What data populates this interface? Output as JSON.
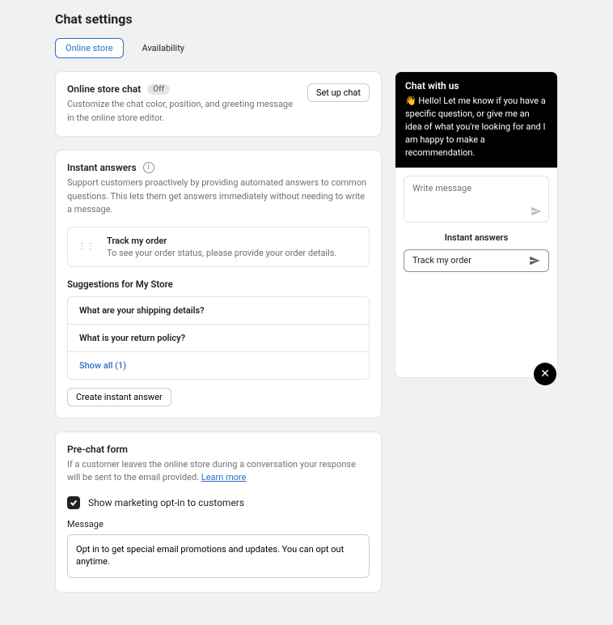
{
  "page": {
    "title": "Chat settings"
  },
  "tabs": {
    "online_store": "Online store",
    "availability": "Availability"
  },
  "online_store_chat": {
    "title": "Online store chat",
    "badge": "Off",
    "subtitle": "Customize the chat color, position, and greeting message in the online store editor.",
    "setup_btn": "Set up chat"
  },
  "instant_answers": {
    "title": "Instant answers",
    "desc": "Support customers proactively by providing automated answers to common questions. This lets them get answers immediately without needing to write a message.",
    "track": {
      "title": "Track my order",
      "sub": "To see your order status, please provide your order details."
    },
    "suggestions_title": "Suggestions for My Store",
    "suggestions": {
      "s1": "What are your shipping details?",
      "s2": "What is your return policy?",
      "show_all": "Show all (1)"
    },
    "create_btn": "Create instant answer"
  },
  "prechat": {
    "title": "Pre-chat form",
    "desc_prefix": "If a customer leaves the online store during a conversation your response will be sent to the email provided. ",
    "learn_more": "Learn more",
    "checkbox_label": "Show marketing opt-in to customers",
    "message_label": "Message",
    "message_value": "Opt in to get special email promotions and updates. You can opt out anytime."
  },
  "preview": {
    "title": "Chat with us",
    "greeting": "👋 Hello! Let me know if you have a specific question, or give me an idea of what you're looking for and I am happy to make a recommendation.",
    "placeholder": "Write message",
    "instant_answers_label": "Instant answers",
    "chip": "Track my order"
  }
}
